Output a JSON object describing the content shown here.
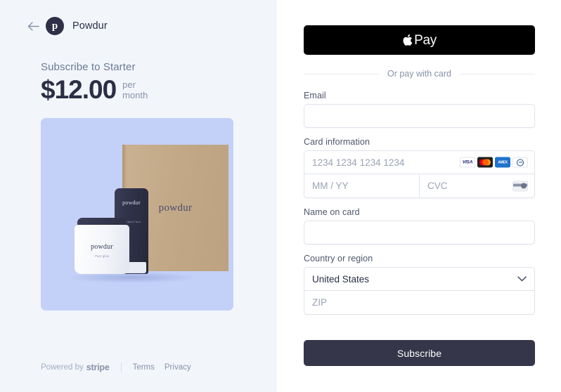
{
  "summary": {
    "back_icon": "back-arrow-icon",
    "merchant_logo_letter": "p",
    "merchant_name": "Powdur",
    "plan_label": "Subscribe to Starter",
    "price_amount": "$12.00",
    "interval_line1": "per",
    "interval_line2": "month",
    "product_image": {
      "box_brand": "powdur",
      "tube_brand": "powdur",
      "tube_subtitle": "Banana Face",
      "jar_brand": "powdur",
      "jar_subtitle": "Pure glow",
      "background_color": "#c3d0f7"
    },
    "footer": {
      "powered_by": "Powered by",
      "stripe_word": "stripe",
      "terms": "Terms",
      "privacy": "Privacy"
    }
  },
  "payment": {
    "apple_pay": {
      "glyph": "apple-logo-icon",
      "label": "Pay"
    },
    "divider_text": "Or pay with card",
    "email": {
      "label": "Email",
      "value": "",
      "placeholder": ""
    },
    "card": {
      "label": "Card information",
      "number_placeholder": "1234 1234 1234 1234",
      "number_value": "",
      "expiry_placeholder": "MM / YY",
      "expiry_value": "",
      "cvc_placeholder": "CVC",
      "cvc_value": "",
      "brands": [
        "VISA",
        "Mastercard",
        "American Express",
        "Diners Club"
      ],
      "visa_text": "VISA",
      "amex_text": "AMEX"
    },
    "name_on_card": {
      "label": "Name on card",
      "value": "",
      "placeholder": ""
    },
    "country": {
      "label": "Country or region",
      "selected": "United States",
      "zip_placeholder": "ZIP",
      "zip_value": ""
    },
    "submit_label": "Subscribe",
    "accent_color": "#353649"
  }
}
